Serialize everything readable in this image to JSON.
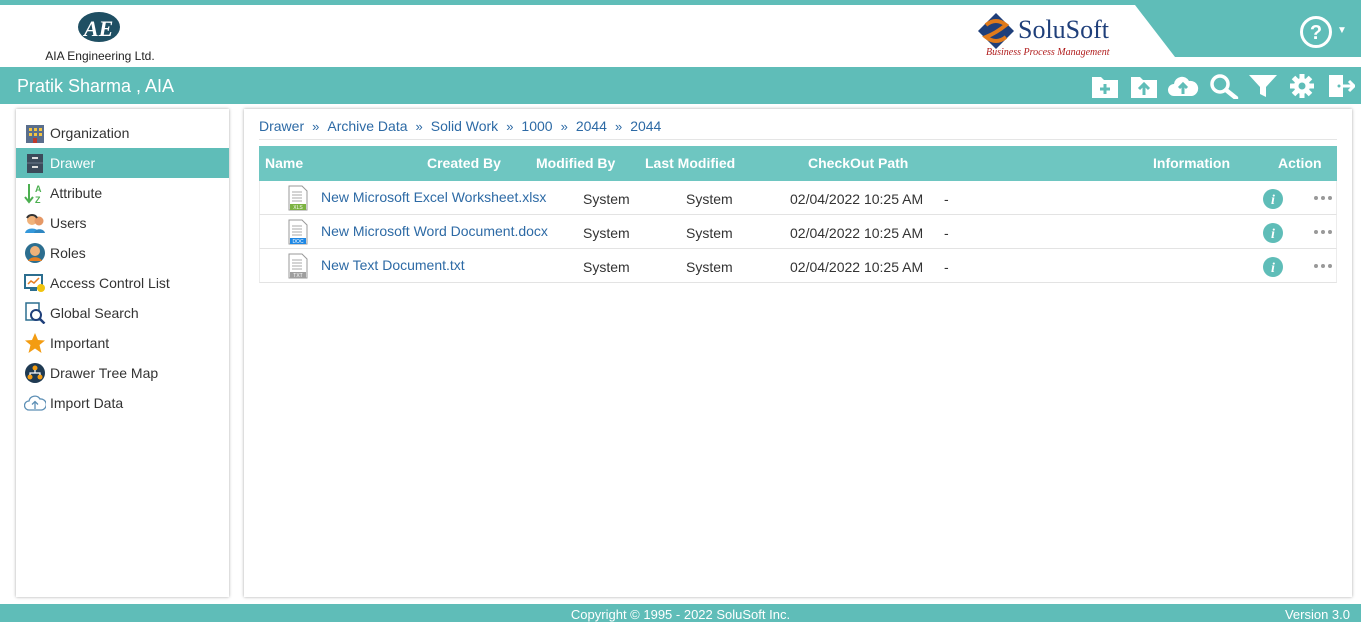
{
  "header": {
    "company_name": "AIA Engineering Ltd.",
    "brand_name": "SoluSoft",
    "brand_tagline": "Business Process Management",
    "help_icon": "help-circle-icon"
  },
  "userbar": {
    "user_label": "Pratik Sharma , AIA",
    "toolbar_icons": [
      "new-folder-icon",
      "upload-folder-icon",
      "cloud-upload-icon",
      "search-icon",
      "filter-icon",
      "gear-icon",
      "logout-icon"
    ]
  },
  "sidebar": {
    "items": [
      {
        "label": "Organization",
        "icon": "organization-icon"
      },
      {
        "label": "Drawer",
        "icon": "drawer-icon",
        "active": true
      },
      {
        "label": "Attribute",
        "icon": "sort-az-icon"
      },
      {
        "label": "Users",
        "icon": "users-icon"
      },
      {
        "label": "Roles",
        "icon": "roles-icon"
      },
      {
        "label": "Access Control List",
        "icon": "access-control-icon"
      },
      {
        "label": "Global Search",
        "icon": "global-search-icon"
      },
      {
        "label": "Important",
        "icon": "star-icon"
      },
      {
        "label": "Drawer Tree Map",
        "icon": "tree-map-icon"
      },
      {
        "label": "Import Data",
        "icon": "cloud-import-icon"
      }
    ]
  },
  "breadcrumb": {
    "items": [
      "Drawer",
      "Archive Data",
      "Solid Work",
      "1000",
      "2044",
      "2044"
    ],
    "separator": "»"
  },
  "table": {
    "columns": {
      "name": "Name",
      "created_by": "Created By",
      "modified_by": "Modified By",
      "last_modified": "Last Modified",
      "checkout_path": "CheckOut Path",
      "information": "Information",
      "action": "Action"
    },
    "rows": [
      {
        "file_name": "New Microsoft Excel Worksheet.xlsx",
        "file_type": "XLS",
        "created_by": "System",
        "modified_by": "System",
        "last_modified": "02/04/2022 10:25 AM",
        "checkout_path": "-"
      },
      {
        "file_name": "New Microsoft Word Document.docx",
        "file_type": "DOC",
        "created_by": "System",
        "modified_by": "System",
        "last_modified": "02/04/2022 10:25 AM",
        "checkout_path": "-"
      },
      {
        "file_name": "New Text Document.txt",
        "file_type": "TXT",
        "created_by": "System",
        "modified_by": "System",
        "last_modified": "02/04/2022 10:25 AM",
        "checkout_path": "-"
      }
    ]
  },
  "footer": {
    "copyright": "Copyright © 1995 - 2022 SoluSoft Inc.",
    "version": "Version 3.0"
  },
  "colors": {
    "accent": "#5fbdb8",
    "table_header": "#6ec6c1",
    "link": "#2d6aa5",
    "info_icon": "#5fbdb8"
  }
}
